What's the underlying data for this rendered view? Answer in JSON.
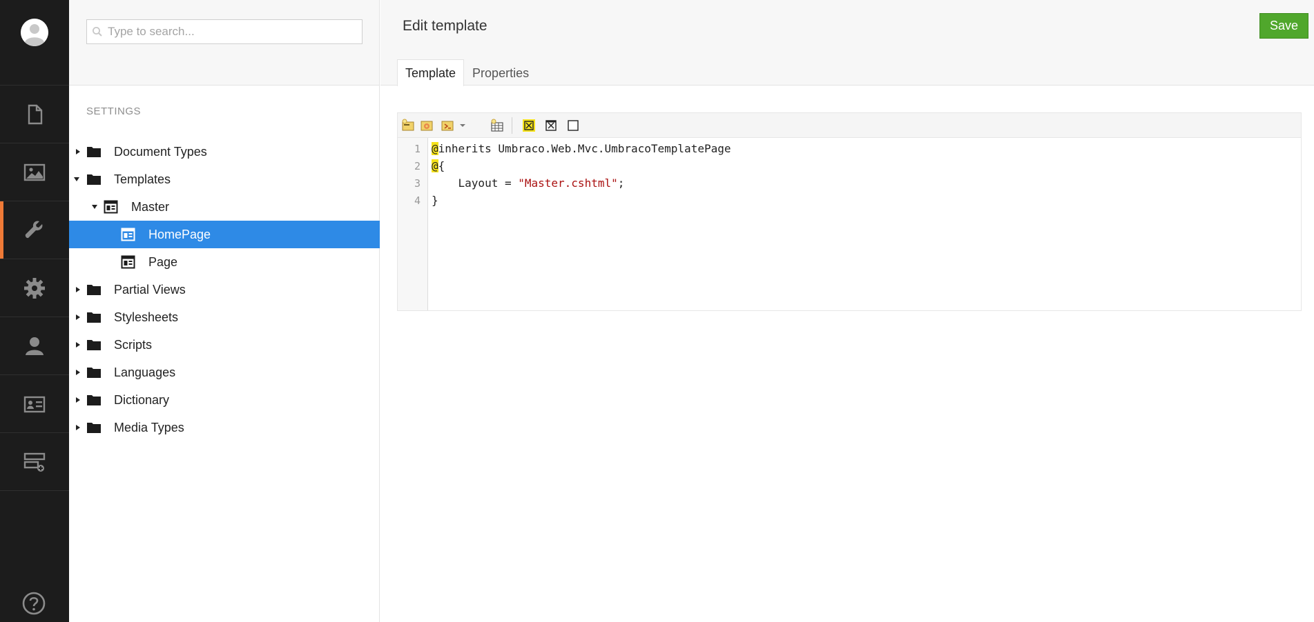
{
  "colors": {
    "section_bg": "#1c1c1c",
    "active_accent": "#ef7a37",
    "selected_node": "#2e8ae6",
    "save_button": "#50a72c",
    "string_literal": "#aa1111",
    "highlight": "#f5e21a"
  },
  "sections": [
    {
      "name": "content",
      "icon": "document-icon",
      "active": false
    },
    {
      "name": "media",
      "icon": "image-icon",
      "active": false
    },
    {
      "name": "settings",
      "icon": "wrench-icon",
      "active": true
    },
    {
      "name": "developer",
      "icon": "gear-icon",
      "active": false
    },
    {
      "name": "users",
      "icon": "user-icon",
      "active": false
    },
    {
      "name": "members",
      "icon": "id-card-icon",
      "active": false
    },
    {
      "name": "forms",
      "icon": "layout-add-icon",
      "active": false
    }
  ],
  "tree": {
    "search_placeholder": "Type to search...",
    "title": "SETTINGS",
    "nodes": [
      {
        "label": "Document Types",
        "icon": "folder-icon",
        "expanded": false
      },
      {
        "label": "Templates",
        "icon": "folder-icon",
        "expanded": true
      },
      {
        "label": "Master",
        "icon": "template-icon",
        "expanded": true
      },
      {
        "label": "HomePage",
        "icon": "template-icon",
        "selected": true
      },
      {
        "label": "Page",
        "icon": "template-icon"
      },
      {
        "label": "Partial Views",
        "icon": "folder-icon",
        "expanded": false
      },
      {
        "label": "Stylesheets",
        "icon": "folder-icon",
        "expanded": false
      },
      {
        "label": "Scripts",
        "icon": "folder-icon",
        "expanded": false
      },
      {
        "label": "Languages",
        "icon": "folder-icon",
        "expanded": false
      },
      {
        "label": "Dictionary",
        "icon": "folder-icon",
        "expanded": false
      },
      {
        "label": "Media Types",
        "icon": "folder-icon",
        "expanded": false
      }
    ]
  },
  "editor": {
    "title": "Edit template",
    "save_label": "Save",
    "tabs": [
      {
        "label": "Template",
        "active": true
      },
      {
        "label": "Properties",
        "active": false
      }
    ],
    "toolbar_icons": [
      "insert-field-icon",
      "insert-macro-icon",
      "insert-script-icon",
      "dropdown-arrow-icon",
      "insert-grid-icon",
      "insert-section-icon",
      "remove-section-icon",
      "render-body-icon"
    ],
    "line_numbers": [
      "1",
      "2",
      "3",
      "4"
    ],
    "code": {
      "line1_at": "@",
      "line1_rest": "inherits Umbraco.Web.Mvc.UmbracoTemplatePage",
      "line2_at": "@",
      "line2_rest": "{",
      "line3_pre": "    Layout = ",
      "line3_str": "\"Master.cshtml\"",
      "line3_post": ";",
      "line4": "}"
    }
  }
}
